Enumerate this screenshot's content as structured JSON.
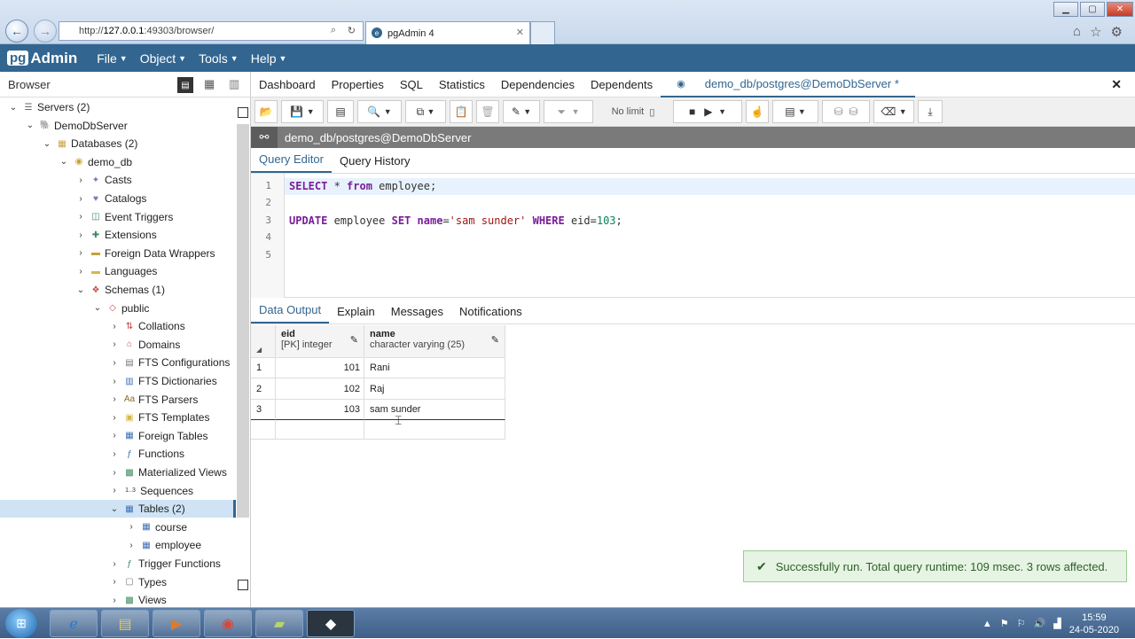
{
  "ie": {
    "url_prefix": "http://",
    "url_host": "127.0.0.1",
    "url_rest": ":49303/browser/",
    "tab_title": "pgAdmin 4"
  },
  "nav": {
    "logo_pg": "pg",
    "logo_text": "Admin",
    "menus": [
      "File",
      "Object",
      "Tools",
      "Help"
    ]
  },
  "browser": {
    "title": "Browser",
    "tree": [
      {
        "label": "Servers (2)",
        "depth": 0,
        "chevron": "open",
        "icon": "servers-icon",
        "glyph": "☰",
        "color": "#666"
      },
      {
        "label": "DemoDbServer",
        "depth": 1,
        "chevron": "open",
        "icon": "elephant-icon",
        "glyph": "🐘",
        "color": "#336791"
      },
      {
        "label": "Databases (2)",
        "depth": 2,
        "chevron": "open",
        "icon": "databases-icon",
        "glyph": "▦",
        "color": "#c7a23a"
      },
      {
        "label": "demo_db",
        "depth": 3,
        "chevron": "open",
        "icon": "database-icon",
        "glyph": "◉",
        "color": "#c7a23a"
      },
      {
        "label": "Casts",
        "depth": 4,
        "chevron": "closed",
        "icon": "casts-icon",
        "glyph": "✦",
        "color": "#8a6fc2"
      },
      {
        "label": "Catalogs",
        "depth": 4,
        "chevron": "closed",
        "icon": "catalogs-icon",
        "glyph": "♥",
        "color": "#8a6fc2"
      },
      {
        "label": "Event Triggers",
        "depth": 4,
        "chevron": "closed",
        "icon": "event-triggers-icon",
        "glyph": "◫",
        "color": "#3d8a5c"
      },
      {
        "label": "Extensions",
        "depth": 4,
        "chevron": "closed",
        "icon": "extensions-icon",
        "glyph": "✚",
        "color": "#3d8a5c"
      },
      {
        "label": "Foreign Data Wrappers",
        "depth": 4,
        "chevron": "closed",
        "icon": "fdw-icon",
        "glyph": "▬",
        "color": "#c7a23a"
      },
      {
        "label": "Languages",
        "depth": 4,
        "chevron": "closed",
        "icon": "languages-icon",
        "glyph": "▬",
        "color": "#d6b84a"
      },
      {
        "label": "Schemas (1)",
        "depth": 4,
        "chevron": "open",
        "icon": "schemas-icon",
        "glyph": "❖",
        "color": "#c44a4a"
      },
      {
        "label": "public",
        "depth": 5,
        "chevron": "open",
        "icon": "schema-icon",
        "glyph": "◇",
        "color": "#c44a4a"
      },
      {
        "label": "Collations",
        "depth": 6,
        "chevron": "closed",
        "icon": "collations-icon",
        "glyph": "⇅",
        "color": "#c44a4a"
      },
      {
        "label": "Domains",
        "depth": 6,
        "chevron": "closed",
        "icon": "domains-icon",
        "glyph": "⌂",
        "color": "#c44a4a"
      },
      {
        "label": "FTS Configurations",
        "depth": 6,
        "chevron": "closed",
        "icon": "fts-config-icon",
        "glyph": "▤",
        "color": "#777"
      },
      {
        "label": "FTS Dictionaries",
        "depth": 6,
        "chevron": "closed",
        "icon": "fts-dict-icon",
        "glyph": "▥",
        "color": "#3d6fb5"
      },
      {
        "label": "FTS Parsers",
        "depth": 6,
        "chevron": "closed",
        "icon": "fts-parsers-icon",
        "glyph": "Aa",
        "color": "#8a6d1f"
      },
      {
        "label": "FTS Templates",
        "depth": 6,
        "chevron": "closed",
        "icon": "fts-templates-icon",
        "glyph": "▣",
        "color": "#d6b84a"
      },
      {
        "label": "Foreign Tables",
        "depth": 6,
        "chevron": "closed",
        "icon": "foreign-tables-icon",
        "glyph": "▦",
        "color": "#3d6fb5"
      },
      {
        "label": "Functions",
        "depth": 6,
        "chevron": "closed",
        "icon": "functions-icon",
        "glyph": "ƒ",
        "color": "#3d6fb5"
      },
      {
        "label": "Materialized Views",
        "depth": 6,
        "chevron": "closed",
        "icon": "mat-views-icon",
        "glyph": "▩",
        "color": "#3d8a5c"
      },
      {
        "label": "Sequences",
        "depth": 6,
        "chevron": "closed",
        "icon": "sequences-icon",
        "glyph": "1..3",
        "color": "#333"
      },
      {
        "label": "Tables (2)",
        "depth": 6,
        "chevron": "open",
        "icon": "tables-icon",
        "glyph": "▦",
        "color": "#3d6fb5",
        "selected": true
      },
      {
        "label": "course",
        "depth": 7,
        "chevron": "closed",
        "icon": "table-icon",
        "glyph": "▦",
        "color": "#3d6fb5"
      },
      {
        "label": "employee",
        "depth": 7,
        "chevron": "closed",
        "icon": "table-icon",
        "glyph": "▦",
        "color": "#3d6fb5"
      },
      {
        "label": "Trigger Functions",
        "depth": 6,
        "chevron": "closed",
        "icon": "trigger-functions-icon",
        "glyph": "ƒ",
        "color": "#3d8a5c"
      },
      {
        "label": "Types",
        "depth": 6,
        "chevron": "closed",
        "icon": "types-icon",
        "glyph": "▢",
        "color": "#777"
      },
      {
        "label": "Views",
        "depth": 6,
        "chevron": "closed",
        "icon": "views-icon",
        "glyph": "▩",
        "color": "#3d8a5c"
      }
    ]
  },
  "main_tabs": [
    "Dashboard",
    "Properties",
    "SQL",
    "Statistics",
    "Dependencies",
    "Dependents"
  ],
  "active_tab": "demo_db/postgres@DemoDbServer *",
  "toolbar": {
    "limit_label": "No limit"
  },
  "connection": "demo_db/postgres@DemoDbServer",
  "query_tabs": [
    "Query Editor",
    "Query History"
  ],
  "editor": {
    "line_numbers": [
      "1",
      "2",
      "3",
      "4",
      "5"
    ],
    "line1": {
      "kw1": "SELECT",
      "star": " *",
      "kw2": "from",
      "rest": " employee;"
    },
    "line3": {
      "kw1": "UPDATE",
      "t1": " employee ",
      "kw2": "SET",
      "t2": " ",
      "kw3": "name",
      "t3": "=",
      "str": "'sam sunder'",
      "t4": " ",
      "kw4": "WHERE",
      "t5": " eid=",
      "num": "103",
      "t6": ";"
    }
  },
  "output_tabs": [
    "Data Output",
    "Explain",
    "Messages",
    "Notifications"
  ],
  "grid": {
    "columns": [
      {
        "name": "eid",
        "type": "[PK] integer"
      },
      {
        "name": "name",
        "type": "character varying (25)"
      }
    ],
    "rows": [
      {
        "n": "1",
        "eid": "101",
        "name": "Rani"
      },
      {
        "n": "2",
        "eid": "102",
        "name": "Raj"
      },
      {
        "n": "3",
        "eid": "103",
        "name": "sam sunder"
      }
    ]
  },
  "toast": "Successfully run. Total query runtime: 109 msec. 3 rows affected.",
  "taskbar": {
    "time": "15:59",
    "date": "24-05-2020"
  }
}
